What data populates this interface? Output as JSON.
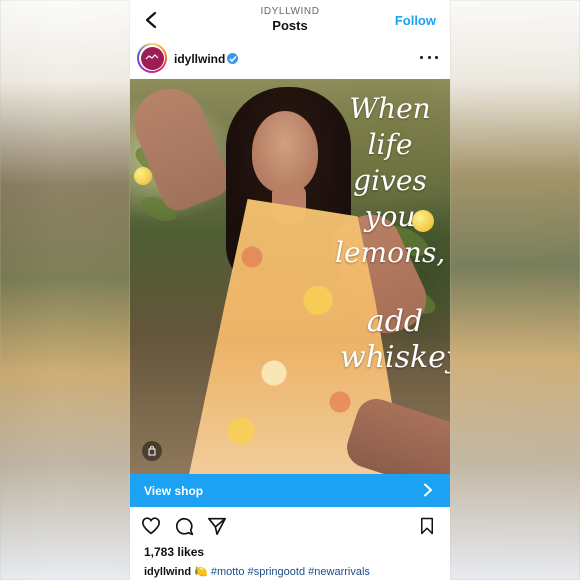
{
  "header": {
    "account_label": "IDYLLWIND",
    "section_title": "Posts",
    "follow_label": "Follow"
  },
  "post": {
    "username": "idyllwind",
    "overlay_text_1": "When life gives you lemons,",
    "overlay_text_2": "add whiskey.",
    "view_shop_label": "View shop",
    "likes_label": "1,783 likes",
    "caption": {
      "user": "idyllwind",
      "emoji": "🍋",
      "hashtags": [
        "#motto",
        "#springootd",
        "#newarrivals"
      ]
    }
  },
  "colors": {
    "brand_blue": "#1da1f2",
    "verified_blue": "#3897f0",
    "avatar_bg": "#9d1d55"
  },
  "icons": {
    "back": "back-arrow-icon",
    "more": "more-options-icon",
    "verified": "verified-badge-icon",
    "tag": "shopping-tag-icon",
    "chevron": "chevron-right-icon",
    "like": "heart-icon",
    "comment": "comment-icon",
    "share": "share-icon",
    "save": "bookmark-icon"
  }
}
